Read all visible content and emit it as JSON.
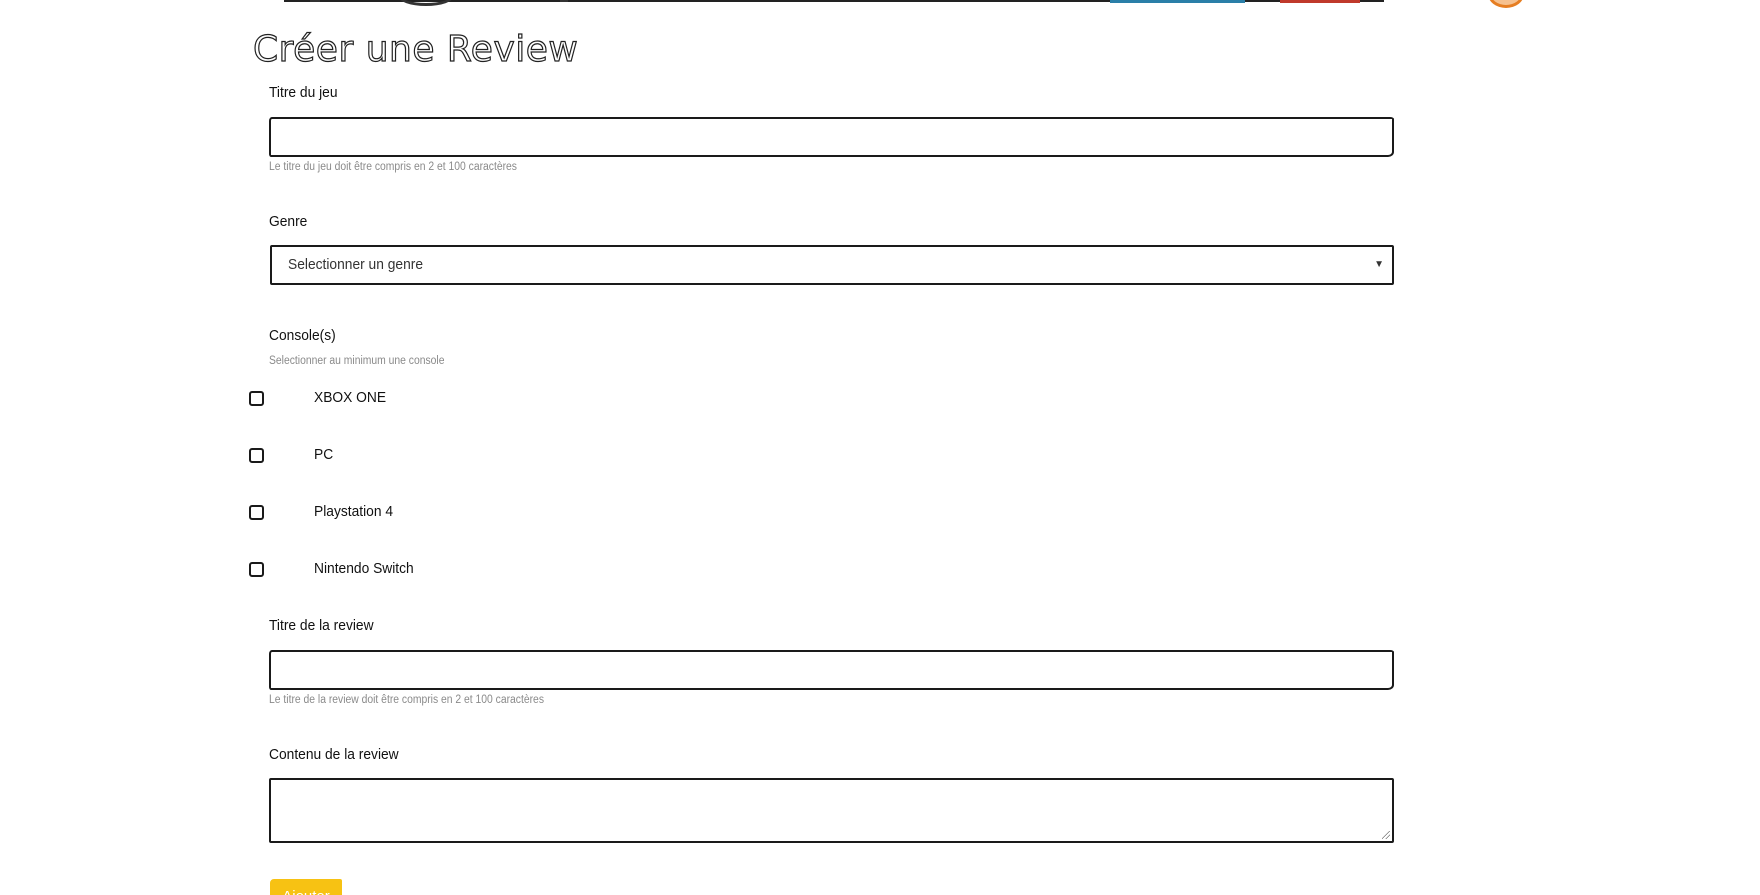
{
  "page": {
    "title": "Créer une Review"
  },
  "form": {
    "game_title": {
      "label": "Titre du jeu",
      "value": "",
      "help": "Le titre du jeu doit être compris en 2 et 100 caractères"
    },
    "genre": {
      "label": "Genre",
      "selected": "Selectionner un genre"
    },
    "consoles": {
      "label": "Console(s)",
      "help": "Selectionner au minimum une console",
      "options": [
        {
          "label": "XBOX ONE",
          "checked": false
        },
        {
          "label": "PC",
          "checked": false
        },
        {
          "label": "Playstation 4",
          "checked": false
        },
        {
          "label": "Nintendo Switch",
          "checked": false
        }
      ]
    },
    "review_title": {
      "label": "Titre de la review",
      "value": "",
      "help": "Le titre de la review doit être compris en 2 et 100 caractères"
    },
    "review_content": {
      "label": "Contenu de la review",
      "value": ""
    },
    "submit_label": "Ajouter"
  },
  "colors": {
    "accent": "#f7c213",
    "border": "#1a1a1a",
    "help_text": "#8a8a8a",
    "header_blue": "#2a7fa8",
    "header_red": "#c0392b"
  },
  "icons": {
    "select_arrow": "chevron-down-icon"
  }
}
